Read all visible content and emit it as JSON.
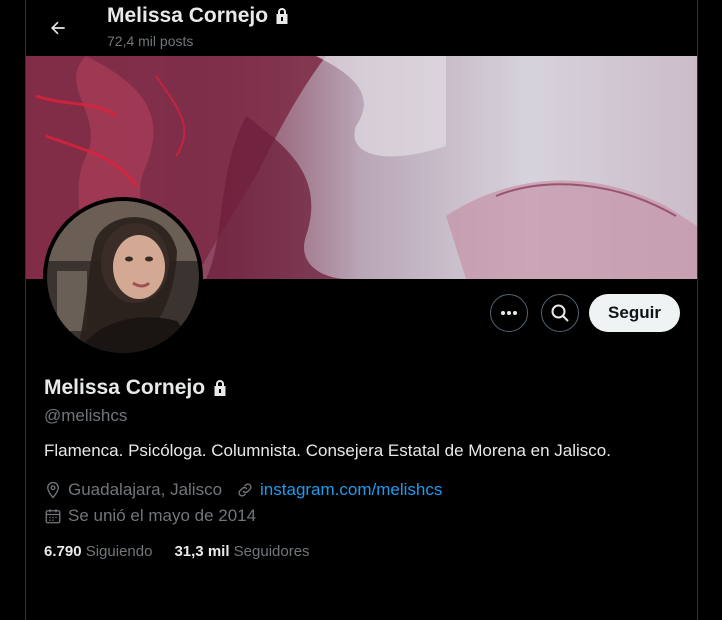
{
  "header": {
    "title": "Melissa Cornejo",
    "posts": "72,4 mil posts"
  },
  "profile": {
    "name": "Melissa Cornejo",
    "handle": "@melishcs",
    "bio": "Flamenca. Psicóloga. Columnista. Consejera Estatal de Morena en Jalisco.",
    "location": "Guadalajara, Jalisco",
    "website": "instagram.com/melishcs",
    "joined": "Se unió el mayo de 2014",
    "following_count": "6.790",
    "following_label": "Siguiendo",
    "followers_count": "31,3 mil",
    "followers_label": "Seguidores"
  },
  "actions": {
    "follow_label": "Seguir"
  },
  "icons": {
    "back": "arrow-left-icon",
    "lock": "lock-icon",
    "more": "more-icon",
    "search": "search-icon",
    "location": "location-pin-icon",
    "link": "link-icon",
    "calendar": "calendar-icon"
  },
  "colors": {
    "background": "#000000",
    "text": "#e7e9ea",
    "muted": "#71767b",
    "link": "#1d9bf0",
    "follow_button": "#eff3f4"
  }
}
